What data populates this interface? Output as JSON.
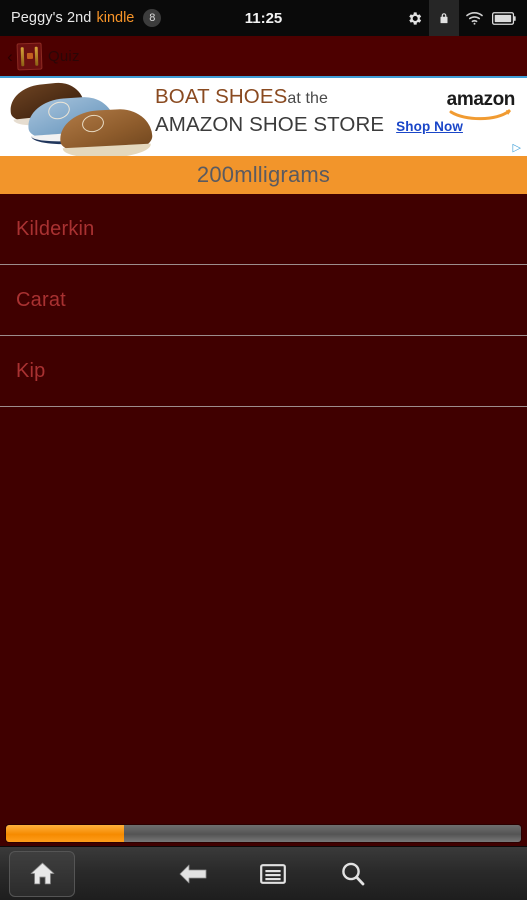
{
  "status_bar": {
    "device_name": "Peggy's 2nd",
    "brand": "kindle",
    "notification_count": "8",
    "clock": "11:25",
    "icons": [
      "gear-icon",
      "lock-icon",
      "wifi-icon",
      "battery-icon"
    ]
  },
  "app_bar": {
    "back_chevron": "‹",
    "title": "Quiz",
    "app_icon": "quiz-app-icon"
  },
  "ad": {
    "headline_top": "BOAT SHOES",
    "headline_top_suffix": "at the",
    "headline_bottom": "AMAZON SHOE STORE",
    "cta": "Shop Now",
    "brand": "amazon",
    "adchoices_glyph": "▷",
    "product_image": "boat-shoes-photo"
  },
  "quiz": {
    "question": "200mlligrams",
    "options": [
      {
        "label": "Kilderkin"
      },
      {
        "label": "Carat"
      },
      {
        "label": "Kip"
      }
    ]
  },
  "progress": {
    "percent": 23,
    "fill_color": "#f58a00",
    "track_color": "#646464"
  },
  "nav_bar": {
    "home_label": "home-icon",
    "back_label": "back-arrow-icon",
    "menu_label": "menu-icon",
    "search_label": "search-icon"
  },
  "colors": {
    "background": "#400000",
    "app_bar": "#4d0000",
    "accent_orange": "#f2952b",
    "option_text": "#a93131",
    "question_text": "#5a5a60"
  }
}
